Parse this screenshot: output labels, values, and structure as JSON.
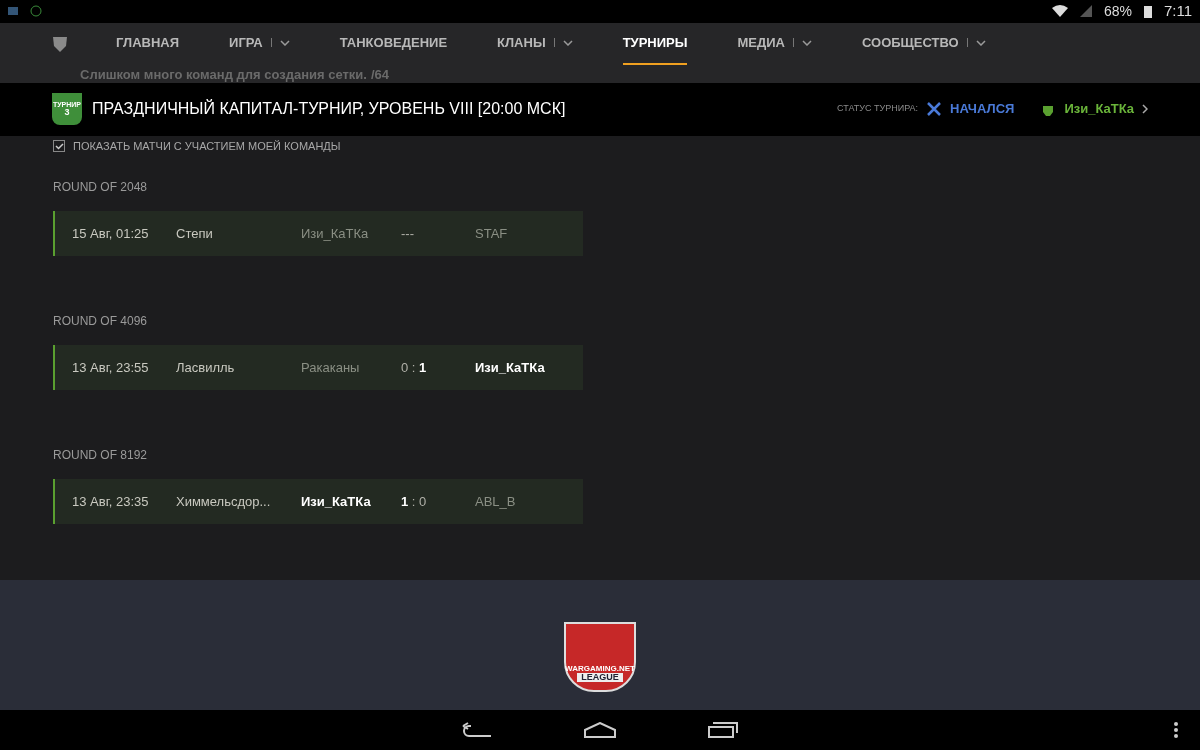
{
  "status_bar": {
    "battery": "68%",
    "time": "7:11"
  },
  "nav": {
    "items": [
      {
        "label": "ГЛАВНАЯ",
        "dropdown": false,
        "selected": false
      },
      {
        "label": "ИГРА",
        "dropdown": true,
        "selected": false
      },
      {
        "label": "ТАНКОВЕДЕНИЕ",
        "dropdown": false,
        "selected": false
      },
      {
        "label": "КЛАНЫ",
        "dropdown": true,
        "selected": false
      },
      {
        "label": "ТУРНИРЫ",
        "dropdown": false,
        "selected": true
      },
      {
        "label": "МЕДИА",
        "dropdown": true,
        "selected": false
      },
      {
        "label": "СООБЩЕСТВО",
        "dropdown": true,
        "selected": false
      }
    ]
  },
  "notice": {
    "text": "Слишком много команд для создания сетки.",
    "limit": "/64"
  },
  "tournament": {
    "badge_top": "ТУРНИР",
    "badge_number": "3",
    "title": "ПРАЗДНИЧНЫЙ КАПИТАЛ-ТУРНИР, УРОВЕНЬ VIII [20:00 МСК]",
    "status_label": "СТАТУС ТУРНИРА:",
    "status": "НАЧАЛСЯ",
    "team": "Изи_КаТКа"
  },
  "filter": {
    "label": "ПОКАЗАТЬ МАТЧИ С УЧАСТИЕМ МОЕЙ КОМАНДЫ",
    "checked": true
  },
  "rounds": [
    {
      "title": "ROUND OF 2048",
      "matches": [
        {
          "date": "15 Авг, 01:25",
          "map": "Степи",
          "team_left": "Изи_КаТКа",
          "left_won": false,
          "score": "---",
          "team_right": "STAF",
          "right_won": false
        }
      ]
    },
    {
      "title": "ROUND OF 4096",
      "matches": [
        {
          "date": "13 Авг, 23:55",
          "map": "Ласвилль",
          "team_left": "Ракаканы",
          "left_won": false,
          "score": "0 : **1**",
          "team_right": "Изи_КаТКа",
          "right_won": true
        }
      ]
    },
    {
      "title": "ROUND OF 8192",
      "matches": [
        {
          "date": "13 Авг, 23:35",
          "map": "Химмельсдор...",
          "team_left": "Изи_КаТКа",
          "left_won": true,
          "score": "**1** : 0",
          "team_right": "ABL_B",
          "right_won": false
        }
      ]
    }
  ],
  "banner": {
    "logo_top": "WARGAMING.NET",
    "logo_bottom": "LEAGUE"
  }
}
